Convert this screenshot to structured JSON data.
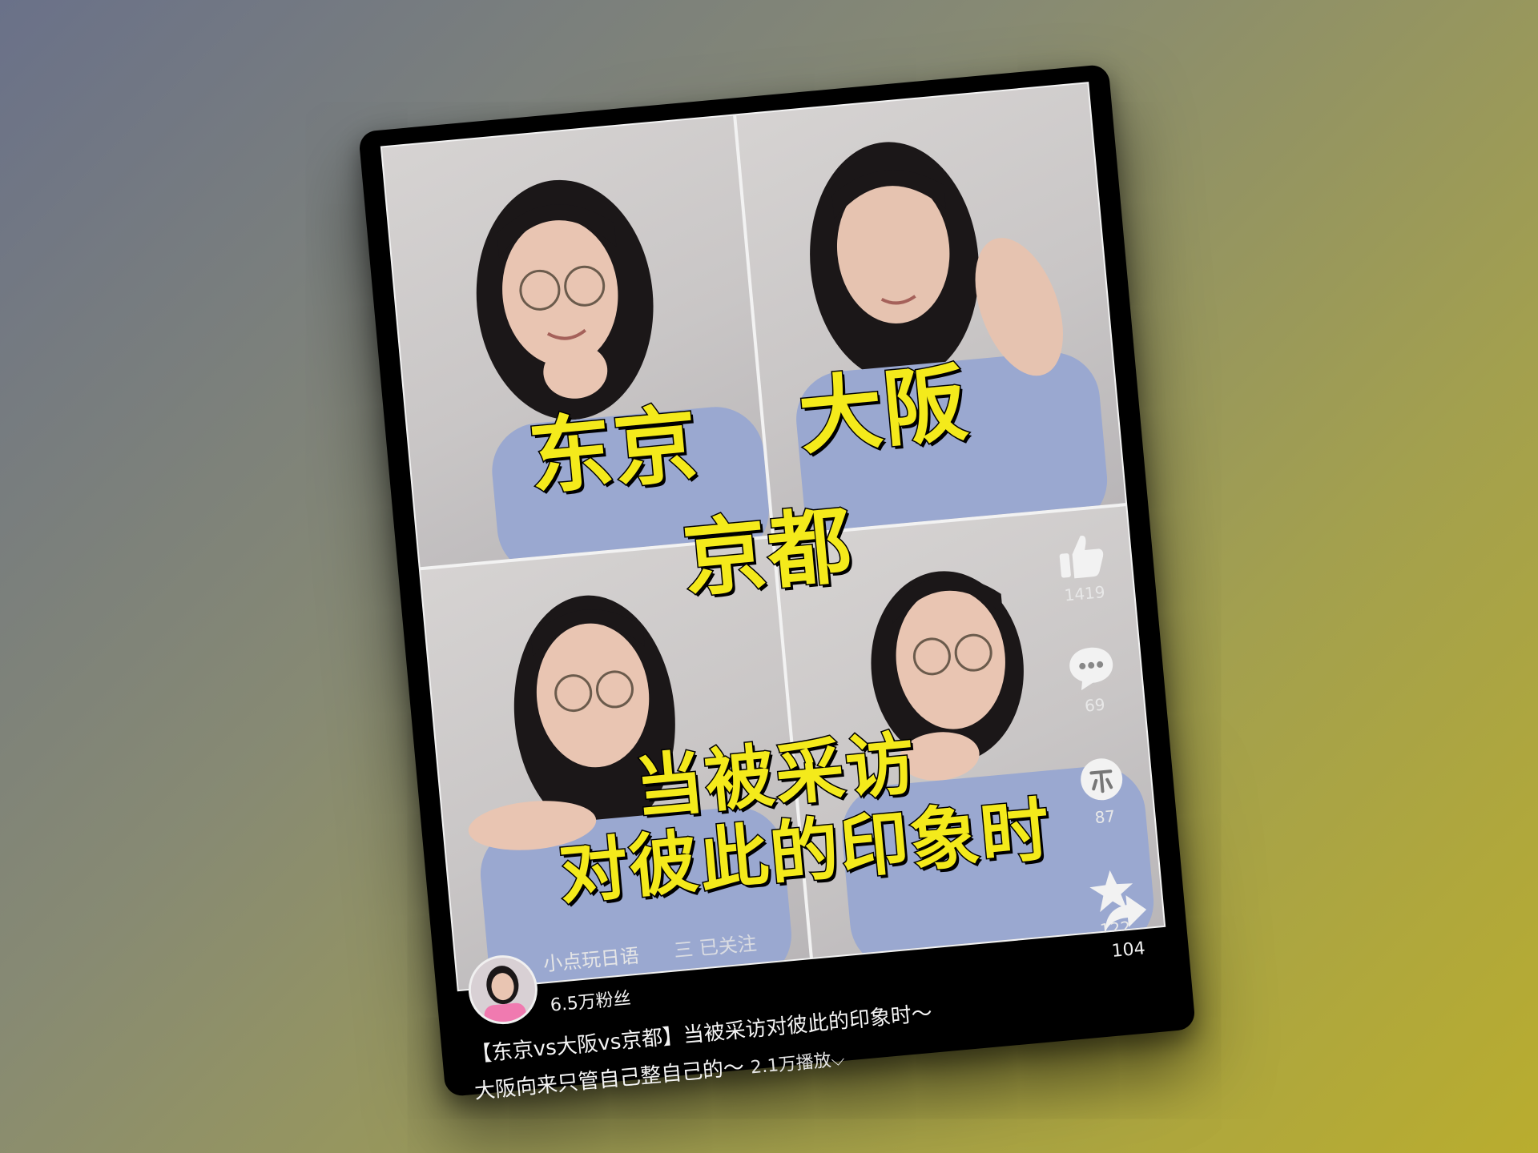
{
  "overlay": {
    "captions": [
      "东京",
      "大阪",
      "京都"
    ],
    "middle_caption_lines": [
      "当被采访",
      "对彼此的印象时"
    ]
  },
  "actions": {
    "like": {
      "count": "1419",
      "icon": "thumbs-up-icon"
    },
    "comment": {
      "count": "69",
      "icon": "comment-bubble-icon"
    },
    "coin": {
      "count": "87",
      "icon": "coin-icon"
    },
    "favorite": {
      "count": "122",
      "icon": "star-icon"
    },
    "share": {
      "count": "104",
      "icon": "share-arrow-icon"
    }
  },
  "author": {
    "name": "小点玩日语",
    "follow_status": "三 已关注",
    "fans": "6.5万粉丝"
  },
  "video": {
    "title_line1": "【东京vs大阪vs京都】当被采访对彼此的印象时～",
    "title_line2": "大阪向来只管自己整自己的～",
    "plays": "2.1万播放",
    "plays_icon": "chevron-down-icon"
  },
  "colors": {
    "caption_yellow": "#f4ea1b",
    "shirt_blue": "#9aa8d0",
    "card_black": "#000000"
  }
}
